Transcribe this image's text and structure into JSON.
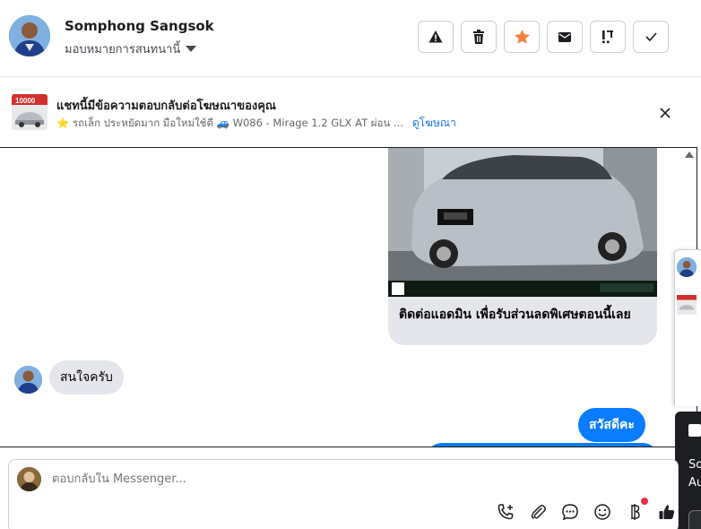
{
  "header": {
    "contact_name": "Somphong Sangsok",
    "assign_label": "มอบหมายการสนทนานี้",
    "toolbar": [
      {
        "name": "report-spam-button",
        "icon": "warning-triangle-icon"
      },
      {
        "name": "delete-button",
        "icon": "trash-icon"
      },
      {
        "name": "star-button",
        "icon": "star-icon",
        "color": "#f5803e"
      },
      {
        "name": "mark-unread-button",
        "icon": "envelope-icon"
      },
      {
        "name": "follow-up-button",
        "icon": "exclamation-icon"
      },
      {
        "name": "mark-done-button",
        "icon": "checkmark-icon"
      }
    ]
  },
  "ad_banner": {
    "title": "แชทนี้มีข้อความตอบกลับต่อโฆษณาของคุณ",
    "description": "⭐ รถเล็ก ประหยัดมาก มือใหม่ใช้ดี 🚙 W086 - Mirage 1.2 GLX AT ผ่อน ...",
    "link_label": "ดูโฆษณา",
    "thumb_badge": "10000"
  },
  "messages": {
    "ad_card_text": "ติดต่อแอดมิน เพื่อรับส่วนลดพิเศษตอนนี้เลย",
    "incoming": "สนใจครับ",
    "outgoing": "สวัสดีคะ"
  },
  "side_popup": {
    "line1": "So",
    "line2": "Au"
  },
  "composer": {
    "placeholder": "ตอบกลับใน Messenger...",
    "icons": [
      "phone-add-icon",
      "paperclip-icon",
      "saved-reply-icon",
      "emoji-icon",
      "payment-icon",
      "thumbs-up-icon"
    ]
  },
  "colors": {
    "accent": "#0a7cff",
    "link": "#1b74e4",
    "notification_dot": "#f02849",
    "star": "#f5803e"
  }
}
